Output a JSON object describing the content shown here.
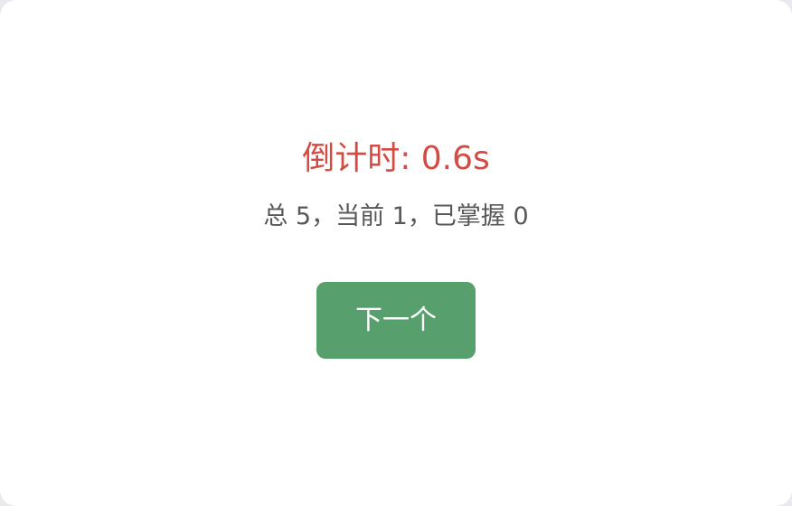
{
  "countdown": {
    "text": "倒计时: 0.6s"
  },
  "stats": {
    "text": "总 5，当前 1，已掌握 0"
  },
  "actions": {
    "next_label": "下一个"
  },
  "colors": {
    "countdown": "#d34b43",
    "button": "#579f6d",
    "stats_text": "#585858",
    "background": "#ffffff"
  }
}
